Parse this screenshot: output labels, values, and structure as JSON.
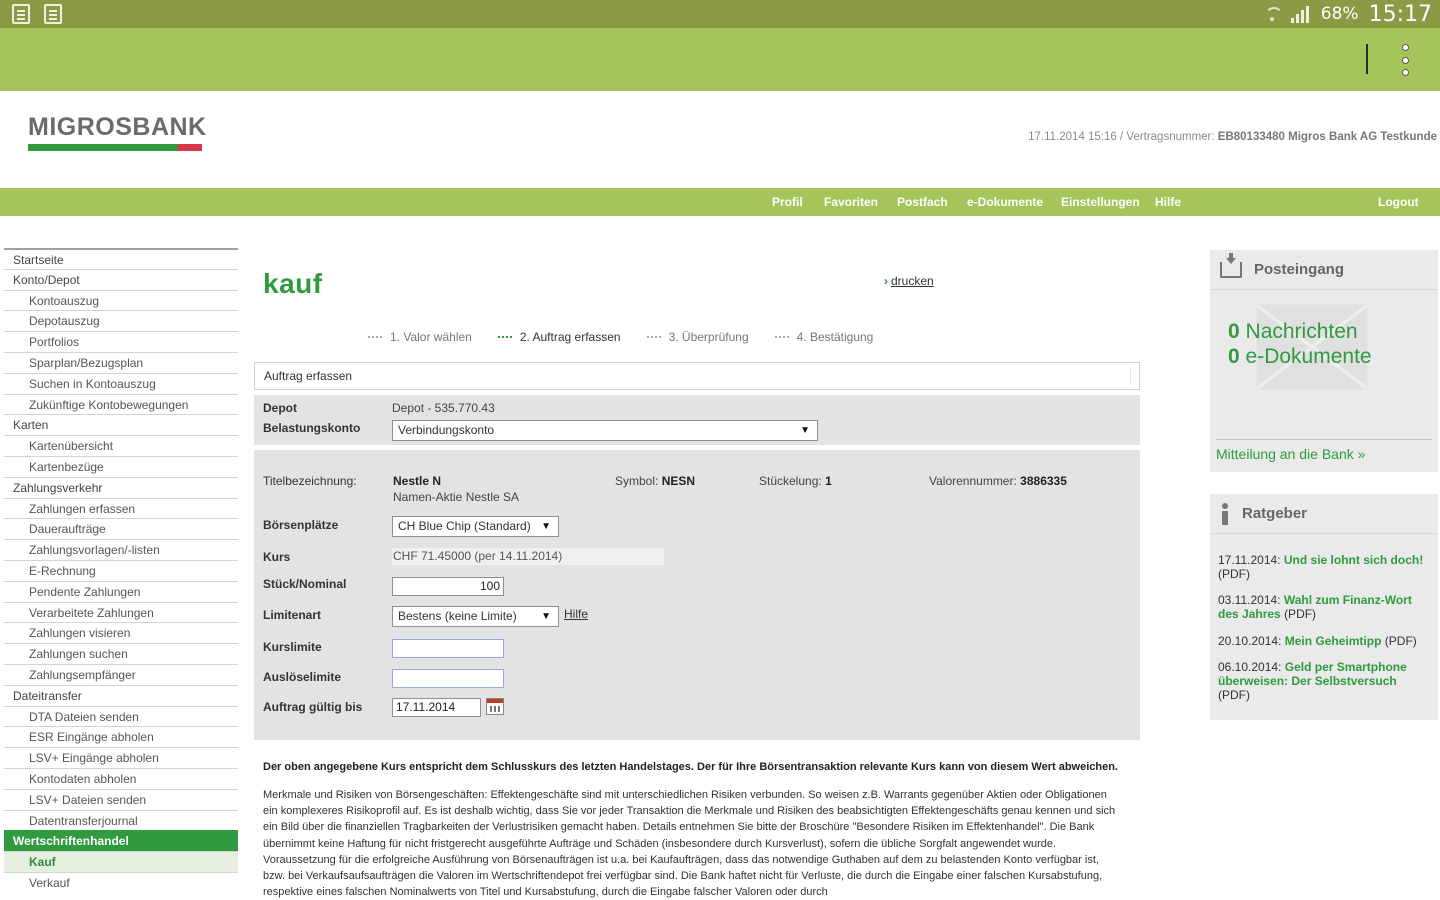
{
  "statusbar": {
    "battery": "68%",
    "time": "15:17"
  },
  "header": {
    "logo": "MIGROSBANK",
    "meta_prefix": "17.11.2014 15:16 / Vertragsnummer:",
    "meta_contract": "EB80133480 Migros Bank AG Testkunde"
  },
  "topnav": [
    "Profil",
    "Favoriten",
    "Postfach",
    "e-Dokumente",
    "Einstellungen",
    "Hilfe",
    "Logout"
  ],
  "sidebar": {
    "items": [
      {
        "label": "Startseite",
        "type": "sect"
      },
      {
        "label": "Konto/Depot",
        "type": "sect"
      },
      {
        "label": "Kontoauszug",
        "type": "sub"
      },
      {
        "label": "Depotauszug",
        "type": "sub"
      },
      {
        "label": "Portfolios",
        "type": "sub"
      },
      {
        "label": "Sparplan/Bezugsplan",
        "type": "sub"
      },
      {
        "label": "Suchen in Kontoauszug",
        "type": "sub"
      },
      {
        "label": "Zukünftige Kontobewegungen",
        "type": "sub"
      },
      {
        "label": "Karten",
        "type": "sect"
      },
      {
        "label": "Kartenübersicht",
        "type": "sub"
      },
      {
        "label": "Kartenbezüge",
        "type": "sub"
      },
      {
        "label": "Zahlungsverkehr",
        "type": "sect"
      },
      {
        "label": "Zahlungen erfassen",
        "type": "sub"
      },
      {
        "label": "Daueraufträge",
        "type": "sub"
      },
      {
        "label": "Zahlungsvorlagen/-listen",
        "type": "sub"
      },
      {
        "label": "E-Rechnung",
        "type": "sub"
      },
      {
        "label": "Pendente Zahlungen",
        "type": "sub"
      },
      {
        "label": "Verarbeitete Zahlungen",
        "type": "sub"
      },
      {
        "label": "Zahlungen visieren",
        "type": "sub"
      },
      {
        "label": "Zahlungen suchen",
        "type": "sub"
      },
      {
        "label": "Zahlungsempfänger",
        "type": "sub"
      },
      {
        "label": "Dateitransfer",
        "type": "sect"
      },
      {
        "label": "DTA Dateien senden",
        "type": "sub"
      },
      {
        "label": "ESR Eingänge abholen",
        "type": "sub"
      },
      {
        "label": "LSV+ Eingänge abholen",
        "type": "sub"
      },
      {
        "label": "Kontodaten abholen",
        "type": "sub"
      },
      {
        "label": "LSV+ Dateien senden",
        "type": "sub"
      },
      {
        "label": "Datentransferjournal",
        "type": "sub"
      },
      {
        "label": "Wertschriftenhandel",
        "type": "active-sect"
      },
      {
        "label": "Kauf",
        "type": "active"
      },
      {
        "label": "Verkauf",
        "type": "sub"
      }
    ]
  },
  "main": {
    "title": "kauf",
    "print_label": "drucken",
    "steps": [
      "1. Valor wählen",
      "2. Auftrag erfassen",
      "3. Überprüfung",
      "4. Bestätigung"
    ],
    "section_title": "Auftrag erfassen",
    "depot_label": "Depot",
    "depot_value": "Depot - 535.770.43",
    "belastung_label": "Belastungskonto",
    "belastung_value": "Verbindungskonto",
    "titel_label": "Titelbezeichnung:",
    "titel_name": "Nestle N",
    "titel_sub": "Namen-Aktie Nestle SA",
    "symbol_label": "Symbol:",
    "symbol_value": "NESN",
    "stueckelung_label": "Stückelung:",
    "stueckelung_value": "1",
    "valoren_label": "Valorennummer:",
    "valoren_value": "3886335",
    "boerse_label": "Börsenplätze",
    "boerse_value": "CH Blue Chip (Standard)",
    "kurs_label": "Kurs",
    "kurs_value": "CHF 71.45000 (per 14.11.2014)",
    "stueck_label": "Stück/Nominal",
    "stueck_value": "100",
    "limitenart_label": "Limitenart",
    "limitenart_value": "Bestens (keine Limite)",
    "hilfe_label": "Hilfe",
    "kurslimite_label": "Kurslimite",
    "kurslimite_value": "",
    "ausloese_label": "Auslöselimite",
    "ausloese_value": "",
    "gueltig_label": "Auftrag gültig bis",
    "gueltig_value": "17.11.2014",
    "notice": "Der oben angegebene Kurs entspricht dem Schlusskurs des letzten Handelstages. Der für Ihre Börsentransaktion relevante Kurs kann von diesem Wert abweichen.",
    "paragraph": "Merkmale und Risiken von Börsengeschäften: Effektengeschäfte sind mit unterschiedlichen Risiken verbunden. So weisen z.B. Warrants gegenüber Aktien oder Obligationen ein komplexeres Risikoprofil auf. Es ist deshalb wichtig, dass Sie vor jeder Transaktion die Merkmale und Risiken des beabsichtigten Effektengeschäfts genau kennen und sich ein Bild über die finanziellen Tragbarkeiten der Verlustrisiken gemacht haben. Details entnehmen Sie bitte der Broschüre \"Besondere Risiken im Effektenhandel\". Die Bank übernimmt keine Haftung für nicht fristgerecht ausgeführte Aufträge und Schäden (insbesondere durch Kursverlust), sofern die übliche Sorgfalt angewendet wurde. Voraussetzung für die erfolgreiche Ausführung von Börsenaufträgen ist u.a. bei Kaufaufträgen, dass das notwendige Guthaben auf dem zu belastenden Konto verfügbar ist, bzw. bei Verkaufsaufsaufträgen die Valoren im Wertschriftendepot frei verfügbar sind. Die Bank haftet nicht für Verluste, die durch die Eingabe einer falschen Kursabstufung, respektive eines falschen Nominalwerts von Titel und Kursabstufung, durch die Eingabe falscher Valoren oder durch"
  },
  "posteingang": {
    "title": "Posteingang",
    "nachrichten_count": "0",
    "nachrichten_label": "Nachrichten",
    "dokumente_count": "0",
    "dokumente_label": "e-Dokumente",
    "link": "Mitteilung an die Bank »"
  },
  "ratgeber": {
    "title": "Ratgeber",
    "items": [
      {
        "date": "17.11.2014:",
        "title": "Und sie lohnt sich doch!",
        "suffix": "(PDF)"
      },
      {
        "date": "03.11.2014:",
        "title": "Wahl zum Finanz-Wort des Jahres",
        "suffix": "(PDF)"
      },
      {
        "date": "20.10.2014:",
        "title": "Mein Geheimtipp",
        "suffix": "(PDF)"
      },
      {
        "date": "06.10.2014:",
        "title": "Geld per Smartphone überweisen: Der Selbstversuch",
        "suffix": "(PDF)"
      }
    ]
  }
}
